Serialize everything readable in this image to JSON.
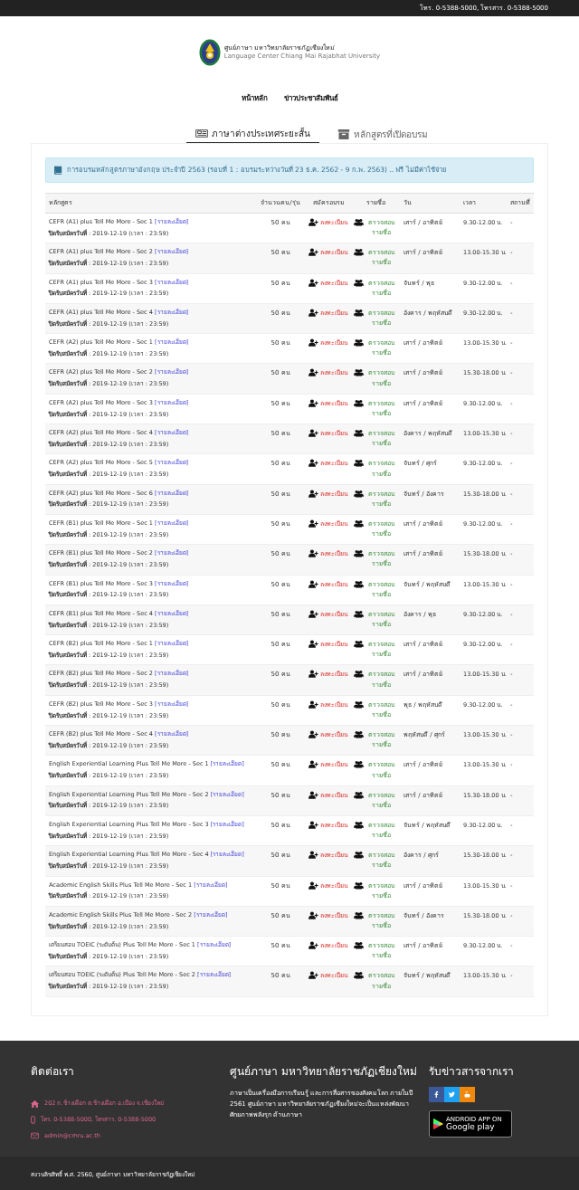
{
  "top_bar": {
    "contact": "โทร. 0-5388-5000, โทรสาร. 0-5388-5000"
  },
  "header": {
    "title_th": "ศูนย์ภาษา มหาวิทยาลัยราชภัฏเชียงใหม่",
    "title_en": "Language Center Chiang Mai Rajabhat University"
  },
  "nav": [
    {
      "label": "หน้าหลัก"
    },
    {
      "label": "ข่าวประชาสัมพันธ์"
    }
  ],
  "tabs": [
    {
      "label": "ภาษาต่างประเทศระยะสั้น",
      "selected": true,
      "kind": "news"
    },
    {
      "label": "หลักสูตรที่เปิดอบรม",
      "selected": false,
      "kind": "archive"
    }
  ],
  "alert": "การอบรมหลักสูตรภาษาอังกฤษ ประจำปี 2563 (รอบที่ 1 : อบรมระหว่างวันที่ 23 ธ.ค. 2562 - 9 ก.พ. 2563) .. ฟรี ไม่มีค่าใช้จ่าย",
  "table": {
    "columns": [
      "หลักสูตร",
      "จำนวนคน/รุ่น",
      "สมัครอบรม",
      "รายชื่อ",
      "วัน",
      "เวลา",
      "สถานที่"
    ],
    "rows": [
      {
        "course": "CEFR (A1) plus Tell Me More - Sec 1",
        "link": "[รายละเอียด]",
        "deadline": "**ปิดรับสมัครวันที่** : 2019-12-19 (เวลา : 23:59)",
        "capacity": "50 คน",
        "register": "ลงทะเบียน",
        "names": "ตรวจสอบ รายชื่อ",
        "days": "เสาร์ / อาทิตย์",
        "time": "9.30-12.00 น.",
        "location": "-"
      },
      {
        "course": "CEFR (A1) plus Tell Me More - Sec 2",
        "link": "[รายละเอียด]",
        "deadline": "**ปิดรับสมัครวันที่** : 2019-12-19 (เวลา : 23:59)",
        "capacity": "50 คน",
        "register": "ลงทะเบียน",
        "names": "ตรวจสอบ รายชื่อ",
        "days": "เสาร์ / อาทิตย์",
        "time": "13.00-15.30 น.",
        "location": "-"
      },
      {
        "course": "CEFR (A1) plus Tell Me More - Sec 3",
        "link": "[รายละเอียด]",
        "deadline": "**ปิดรับสมัครวันที่** : 2019-12-19 (เวลา : 23:59)",
        "capacity": "50 คน",
        "register": "ลงทะเบียน",
        "names": "ตรวจสอบ รายชื่อ",
        "days": "จันทร์ / พุธ",
        "time": "9.30-12.00 น.",
        "location": "-"
      },
      {
        "course": "CEFR (A1) plus Tell Me More - Sec 4",
        "link": "[รายละเอียด]",
        "deadline": "**ปิดรับสมัครวันที่** : 2019-12-19 (เวลา : 23:59)",
        "capacity": "50 คน",
        "register": "ลงทะเบียน",
        "names": "ตรวจสอบ รายชื่อ",
        "days": "อังคาร / พฤหัสบดี",
        "time": "9.30-12.00 น.",
        "location": "-"
      },
      {
        "course": "CEFR (A2) plus Tell Me More - Sec 1",
        "link": "[รายละเอียด]",
        "deadline": "**ปิดรับสมัครวันที่** : 2019-12-19 (เวลา : 23:59)",
        "capacity": "50 คน",
        "register": "ลงทะเบียน",
        "names": "ตรวจสอบ รายชื่อ",
        "days": "เสาร์ / อาทิตย์",
        "time": "13.00-15.30 น.",
        "location": "-"
      },
      {
        "course": "CEFR (A2) plus Tell Me More - Sec 2",
        "link": "[รายละเอียด]",
        "deadline": "**ปิดรับสมัครวันที่** : 2019-12-19 (เวลา : 23:59)",
        "capacity": "50 คน",
        "register": "ลงทะเบียน",
        "names": "ตรวจสอบ รายชื่อ",
        "days": "เสาร์ / อาทิตย์",
        "time": "15.30-18.00 น.",
        "location": "-"
      },
      {
        "course": "CEFR (A2) plus Tell Me More - Sec 3",
        "link": "[รายละเอียด]",
        "deadline": "**ปิดรับสมัครวันที่** : 2019-12-19 (เวลา : 23:59)",
        "capacity": "50 คน",
        "register": "ลงทะเบียน",
        "names": "ตรวจสอบ รายชื่อ",
        "days": "เสาร์ / อาทิตย์",
        "time": "9.30-12.00 น.",
        "location": "-"
      },
      {
        "course": "CEFR (A2) plus Tell Me More - Sec 4",
        "link": "[รายละเอียด]",
        "deadline": "**ปิดรับสมัครวันที่** : 2019-12-19 (เวลา : 23:59)",
        "capacity": "50 คน",
        "register": "ลงทะเบียน",
        "names": "ตรวจสอบ รายชื่อ",
        "days": "อังคาร / พฤหัสบดี",
        "time": "13.00-15.30 น.",
        "location": "-"
      },
      {
        "course": "CEFR (A2) plus Tell Me More - Sec 5",
        "link": "[รายละเอียด]",
        "deadline": "**ปิดรับสมัครวันที่** : 2019-12-19 (เวลา : 23:59)",
        "capacity": "50 คน",
        "register": "ลงทะเบียน",
        "names": "ตรวจสอบ รายชื่อ",
        "days": "จันทร์ / ศุกร์",
        "time": "9.30-12.00 น.",
        "location": "-"
      },
      {
        "course": "CEFR (A2) plus Tell Me More - Sec 6",
        "link": "[รายละเอียด]",
        "deadline": "**ปิดรับสมัครวันที่** : 2019-12-19 (เวลา : 23:59)",
        "capacity": "50 คน",
        "register": "ลงทะเบียน",
        "names": "ตรวจสอบ รายชื่อ",
        "days": "จันทร์ / อังคาร",
        "time": "15.30-18.00 น.",
        "location": "-"
      },
      {
        "course": "CEFR (B1) plus Tell Me More - Sec 1",
        "link": "[รายละเอียด]",
        "deadline": "**ปิดรับสมัครวันที่** : 2019-12-19 (เวลา : 23:59)",
        "capacity": "50 คน",
        "register": "ลงทะเบียน",
        "names": "ตรวจสอบ รายชื่อ",
        "days": "เสาร์ / อาทิตย์",
        "time": "9.30-12.00 น.",
        "location": "-"
      },
      {
        "course": "CEFR (B1) plus Tell Me More - Sec 2",
        "link": "[รายละเอียด]",
        "deadline": "**ปิดรับสมัครวันที่** : 2019-12-19 (เวลา : 23:59)",
        "capacity": "50 คน",
        "register": "ลงทะเบียน",
        "names": "ตรวจสอบ รายชื่อ",
        "days": "เสาร์ / อาทิตย์",
        "time": "15.30-18.00 น.",
        "location": "-"
      },
      {
        "course": "CEFR (B1) plus Tell Me More - Sec 3",
        "link": "[รายละเอียด]",
        "deadline": "**ปิดรับสมัครวันที่** : 2019-12-19 (เวลา : 23:59)",
        "capacity": "50 คน",
        "register": "ลงทะเบียน",
        "names": "ตรวจสอบ รายชื่อ",
        "days": "จันทร์ / พฤหัสบดี",
        "time": "13.00-15.30 น.",
        "location": "-"
      },
      {
        "course": "CEFR (B1) plus Tell Me More - Sec 4",
        "link": "[รายละเอียด]",
        "deadline": "**ปิดรับสมัครวันที่** : 2019-12-19 (เวลา : 23:59)",
        "capacity": "50 คน",
        "register": "ลงทะเบียน",
        "names": "ตรวจสอบ รายชื่อ",
        "days": "อังคาร / พุธ",
        "time": "9.30-12.00 น.",
        "location": "-"
      },
      {
        "course": "CEFR (B2) plus Tell Me More - Sec 1",
        "link": "[รายละเอียด]",
        "deadline": "**ปิดรับสมัครวันที่** : 2019-12-19 (เวลา : 23:59)",
        "capacity": "50 คน",
        "register": "ลงทะเบียน",
        "names": "ตรวจสอบ รายชื่อ",
        "days": "เสาร์ / อาทิตย์",
        "time": "9.30-12.00 น.",
        "location": "-"
      },
      {
        "course": "CEFR (B2) plus Tell Me More - Sec 2",
        "link": "[รายละเอียด]",
        "deadline": "**ปิดรับสมัครวันที่** : 2019-12-19 (เวลา : 23:59)",
        "capacity": "50 คน",
        "register": "ลงทะเบียน",
        "names": "ตรวจสอบ รายชื่อ",
        "days": "เสาร์ / อาทิตย์",
        "time": "13.00-15.30 น.",
        "location": "-"
      },
      {
        "course": "CEFR (B2) plus Tell Me More - Sec 3",
        "link": "[รายละเอียด]",
        "deadline": "**ปิดรับสมัครวันที่** : 2019-12-19 (เวลา : 23:59)",
        "capacity": "50 คน",
        "register": "ลงทะเบียน",
        "names": "ตรวจสอบ รายชื่อ",
        "days": "พุธ / พฤหัสบดี",
        "time": "9.30-12.00 น.",
        "location": "-"
      },
      {
        "course": "CEFR (B2) plus Tell Me More - Sec 4",
        "link": "[รายละเอียด]",
        "deadline": "**ปิดรับสมัครวันที่** : 2019-12-19 (เวลา : 23:59)",
        "capacity": "50 คน",
        "register": "ลงทะเบียน",
        "names": "ตรวจสอบ รายชื่อ",
        "days": "พฤหัสบดี / ศุกร์",
        "time": "13.00-15.30 น.",
        "location": "-"
      },
      {
        "course": "English Experiential Learning Plus Tell Me More - Sec 1",
        "link": "[รายละเอียด]",
        "deadline": "**ปิดรับสมัครวันที่** : 2019-12-19 (เวลา : 23:59)",
        "capacity": "50 คน",
        "register": "ลงทะเบียน",
        "names": "ตรวจสอบ รายชื่อ",
        "days": "เสาร์ / อาทิตย์",
        "time": "13.00-15.30 น.",
        "location": "-"
      },
      {
        "course": "English Experiential Learning Plus Tell Me More - Sec 2",
        "link": "[รายละเอียด]",
        "deadline": "**ปิดรับสมัครวันที่** : 2019-12-19 (เวลา : 23:59)",
        "capacity": "50 คน",
        "register": "ลงทะเบียน",
        "names": "ตรวจสอบ รายชื่อ",
        "days": "เสาร์ / อาทิตย์",
        "time": "15.30-18.00 น.",
        "location": "-"
      },
      {
        "course": "English Experiential Learning Plus Tell Me More - Sec 3",
        "link": "[รายละเอียด]",
        "deadline": "**ปิดรับสมัครวันที่** : 2019-12-19 (เวลา : 23:59)",
        "capacity": "50 คน",
        "register": "ลงทะเบียน",
        "names": "ตรวจสอบ รายชื่อ",
        "days": "จันทร์ / พฤหัสบดี",
        "time": "9.30-12.00 น.",
        "location": "-"
      },
      {
        "course": "English Experiential Learning Plus Tell Me More - Sec 4",
        "link": "[รายละเอียด]",
        "deadline": "**ปิดรับสมัครวันที่** : 2019-12-19 (เวลา : 23:59)",
        "capacity": "50 คน",
        "register": "ลงทะเบียน",
        "names": "ตรวจสอบ รายชื่อ",
        "days": "อังคาร / ศุกร์",
        "time": "15.30-18.00 น.",
        "location": "-"
      },
      {
        "course": "Academic English Skills Plus Tell Me More - Sec 1",
        "link": "[รายละเอียด]",
        "deadline": "**ปิดรับสมัครวันที่** : 2019-12-19 (เวลา : 23:59)",
        "capacity": "50 คน",
        "register": "ลงทะเบียน",
        "names": "ตรวจสอบ รายชื่อ",
        "days": "เสาร์ / อาทิตย์",
        "time": "13.00-15.30 น.",
        "location": "-"
      },
      {
        "course": "Academic English Skills Plus Tell Me More - Sec 2",
        "link": "[รายละเอียด]",
        "deadline": "**ปิดรับสมัครวันที่** : 2019-12-19 (เวลา : 23:59)",
        "capacity": "50 คน",
        "register": "ลงทะเบียน",
        "names": "ตรวจสอบ รายชื่อ",
        "days": "จันทร์ / อังคาร",
        "time": "15.30-18.00 น.",
        "location": "-"
      },
      {
        "course": "เตรียมสอบ TOEIC (ระดับต้น) Plus Tell Me More - Sec 1",
        "link": "[รายละเอียด]",
        "deadline": "**ปิดรับสมัครวันที่** : 2019-12-19 (เวลา : 23:59)",
        "capacity": "50 คน",
        "register": "ลงทะเบียน",
        "names": "ตรวจสอบ รายชื่อ",
        "days": "เสาร์ / อาทิตย์",
        "time": "9.30-12.00 น.",
        "location": "-"
      },
      {
        "course": "เตรียมสอบ TOEIC (ระดับต้น) Plus Tell Me More - Sec 2",
        "link": "[รายละเอียด]",
        "deadline": "**ปิดรับสมัครวันที่** : 2019-12-19 (เวลา : 23:59)",
        "capacity": "50 คน",
        "register": "ลงทะเบียน",
        "names": "ตรวจสอบ รายชื่อ",
        "days": "จันทร์ / พฤหัสบดี",
        "time": "13.00-15.30 น.",
        "location": "-"
      }
    ]
  },
  "footer": {
    "contact_title": "ติดต่อเรา",
    "contacts": [
      {
        "kind": "home",
        "text": "202 ถ.ช้างเผือก ต.ช้างเผือก อ.เมือง จ.เชียงใหม่"
      },
      {
        "kind": "phone",
        "text": "โทร. 0-5388-5000, โทรสาร. 0-5388-5000"
      },
      {
        "kind": "mail",
        "text": "admin@cmru.ac.th"
      }
    ],
    "about_title": "ศูนย์ภาษา มหาวิทยาลัยราชภัฏเชียงใหม่",
    "about_text": "ภาษาเป็นเครื่องมือการเรียนรู้ และการสื่อสารของสังคมโลก ภายในปี 2561 ศูนย์ภาษา มหาวิทยาลัยราชภัฏเชียงใหม่จะเป็นแหล่งพัฒนาศักยภาพพลังรุก ด้านภาษา",
    "news_title": "รับข่าวสารจากเรา",
    "social": [
      {
        "kind": "facebook",
        "color": "#3b5998"
      },
      {
        "kind": "twitter",
        "color": "#1da1f2"
      },
      {
        "kind": "youtube",
        "color": "#f0880e"
      }
    ],
    "store_badge": {
      "small": "ANDROID APP ON",
      "large": "Google play"
    },
    "copyright": "สงวนลิขสิทธิ์ พ.ศ. 2560, ศูนย์ภาษา มหาวิทยาลัยราชภัฏเชียงใหม่"
  }
}
